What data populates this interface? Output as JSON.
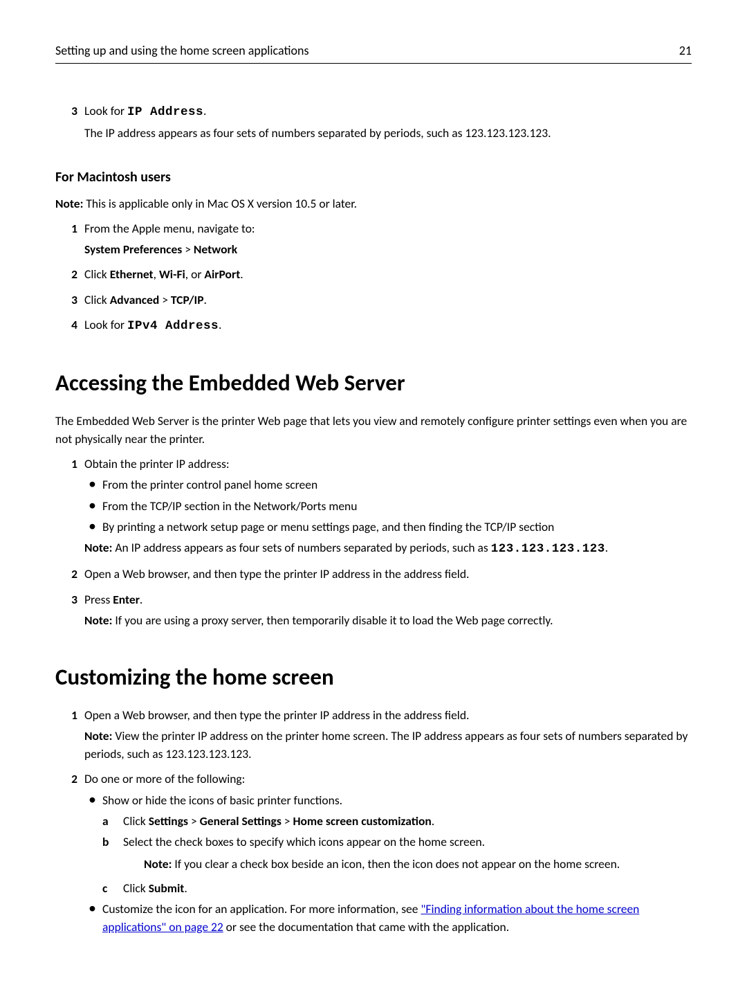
{
  "header": {
    "title": "Setting up and using the home screen applications",
    "page_number": "21"
  },
  "prev_step": {
    "num": "3",
    "pre": "Look for ",
    "code": "IP Address",
    "post": ".",
    "desc": "The IP address appears as four sets of numbers separated by periods, such as 123.123.123.123."
  },
  "mac": {
    "heading": "For Macintosh users",
    "note_label": "Note:",
    "note_text": " This is applicable only in Mac OS X version 10.5 or later.",
    "s1": {
      "num": "1",
      "text": "From the Apple menu, navigate to:",
      "path_a": "System Preferences",
      "sep": " > ",
      "path_b": "Network"
    },
    "s2": {
      "num": "2",
      "pre": "Click ",
      "a": "Ethernet",
      "c1": ", ",
      "b": "Wi-Fi",
      "c2": ", or ",
      "c": "AirPort",
      "post": "."
    },
    "s3": {
      "num": "3",
      "pre": "Click ",
      "a": "Advanced",
      "sep": " > ",
      "b": "TCP/IP",
      "post": "."
    },
    "s4": {
      "num": "4",
      "pre": "Look for ",
      "code": "IPv4 Address",
      "post": "."
    }
  },
  "ews": {
    "heading": "Accessing the Embedded Web Server",
    "intro": "The Embedded Web Server is the printer Web page that lets you view and remotely configure printer settings even when you are not physically near the printer.",
    "s1": {
      "num": "1",
      "text": "Obtain the printer IP address:",
      "b1": "From the printer control panel home screen",
      "b2": "From the TCP/IP section in the Network/Ports menu",
      "b3": "By printing a network setup page or menu settings page, and then finding the TCP/IP section",
      "note_label": "Note:",
      "note_pre": " An IP address appears as four sets of numbers separated by periods, such as ",
      "note_code": "123.123.123.123",
      "note_post": "."
    },
    "s2": {
      "num": "2",
      "text": "Open a Web browser, and then type the printer IP address in the address field."
    },
    "s3": {
      "num": "3",
      "pre": "Press ",
      "b": "Enter",
      "post": ".",
      "note_label": "Note:",
      "note_text": " If you are using a proxy server, then temporarily disable it to load the Web page correctly."
    }
  },
  "custom": {
    "heading": "Customizing the home screen",
    "s1": {
      "num": "1",
      "text": "Open a Web browser, and then type the printer IP address in the address field.",
      "note_label": "Note:",
      "note_text": " View the printer IP address on the printer home screen. The IP address appears as four sets of numbers separated by periods, such as 123.123.123.123."
    },
    "s2": {
      "num": "2",
      "text": "Do one or more of the following:",
      "b1": "Show or hide the icons of basic printer functions.",
      "a": {
        "letter": "a",
        "pre": "Click ",
        "p1": "Settings",
        "sep": " > ",
        "p2": "General Settings",
        "p3": "Home screen customization",
        "post": "."
      },
      "b": {
        "letter": "b",
        "text": "Select the check boxes to specify which icons appear on the home screen.",
        "note_label": "Note:",
        "note_text": " If you clear a check box beside an icon, then the icon does not appear on the home screen."
      },
      "c": {
        "letter": "c",
        "pre": "Click ",
        "b": "Submit",
        "post": "."
      },
      "b2_pre": "Customize the icon for an application. For more information, see ",
      "b2_link": "\"Finding information about the home screen applications\" on page 22",
      "b2_post": " or see the documentation that came with the application."
    }
  }
}
